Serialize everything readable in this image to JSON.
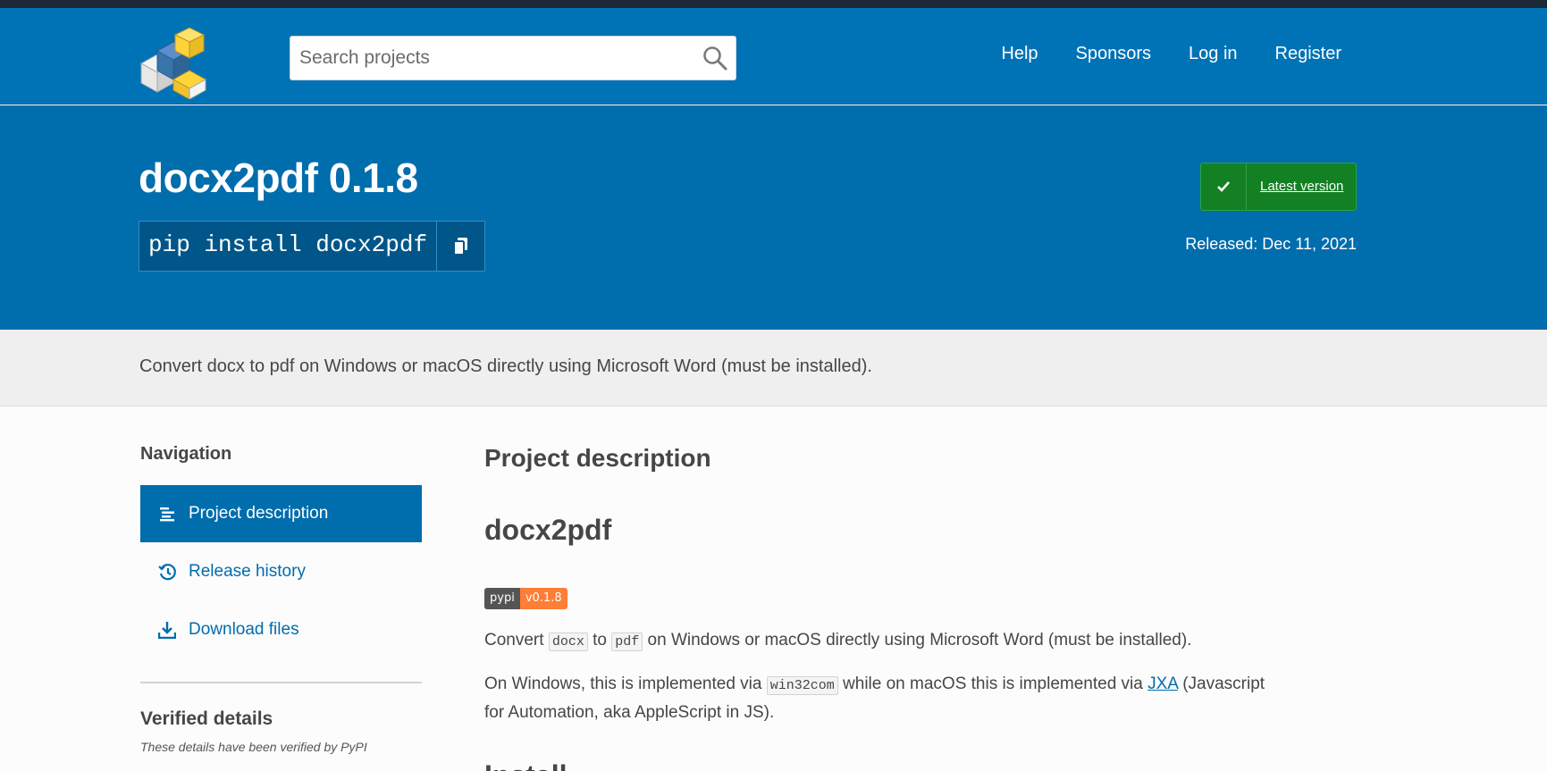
{
  "header": {
    "search_placeholder": "Search projects",
    "nav": [
      "Help",
      "Sponsors",
      "Log in",
      "Register"
    ]
  },
  "package": {
    "title": "docx2pdf 0.1.8",
    "pip_command": "pip install docx2pdf",
    "latest_label": "Latest version",
    "released": "Released: Dec 11, 2021",
    "summary": "Convert docx to pdf on Windows or macOS directly using Microsoft Word (must be installed)."
  },
  "sidebar": {
    "title": "Navigation",
    "items": [
      {
        "label": "Project description",
        "icon": "align-left-icon",
        "active": true
      },
      {
        "label": "Release history",
        "icon": "history-icon",
        "active": false
      },
      {
        "label": "Download files",
        "icon": "download-icon",
        "active": false
      }
    ],
    "verified_title": "Verified details",
    "verified_sub": "These details have been verified by PyPI"
  },
  "main": {
    "title": "Project description",
    "readme_title": "docx2pdf",
    "badge_left": "pypi",
    "badge_right": "v0.1.8",
    "para1": {
      "t1": "Convert ",
      "c1": "docx",
      "t2": " to ",
      "c2": "pdf",
      "t3": " on Windows or macOS directly using Microsoft Word (must be installed)."
    },
    "para2": {
      "t1": "On Windows, this is implemented via ",
      "c1": "win32com",
      "t2": " while on macOS this is implemented via ",
      "link": "JXA",
      "t3": " (Javascript for Automation, aka AppleScript in JS)."
    },
    "next_heading": "Install"
  },
  "colors": {
    "header_blue": "#0073b7",
    "banner_blue": "#006dad",
    "latest_green": "#148024",
    "badge_orange": "#fe7d37"
  }
}
